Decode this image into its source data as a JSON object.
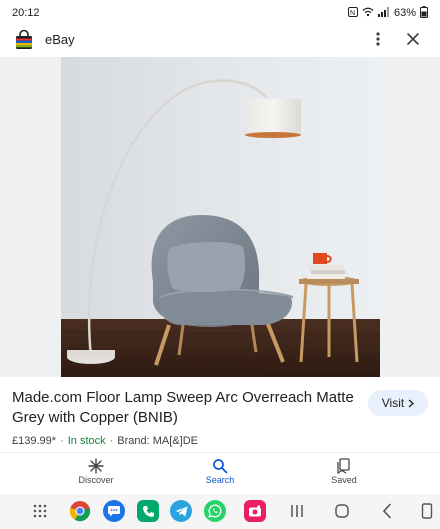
{
  "status_bar": {
    "time": "20:12",
    "battery": "63%",
    "icons": [
      "nfc-icon",
      "wifi-icon",
      "signal-icon"
    ]
  },
  "app_bar": {
    "title": "eBay",
    "app_icon": "shopping-bag-icon",
    "more_icon": "more-vertical-icon",
    "close_icon": "close-icon"
  },
  "product": {
    "title": "Made.com Floor Lamp Sweep Arc Overreach Matte Grey with Copper (BNIB)",
    "price": "£139.99*",
    "stock": "In stock",
    "brand": "Brand: MA[&]DE",
    "visit_label": "Visit",
    "visit_icon": "chevron-right-icon"
  },
  "bottom_nav": {
    "items": [
      {
        "label": "Discover",
        "icon": "asterisk-icon",
        "active": false
      },
      {
        "label": "Search",
        "icon": "search-icon",
        "active": true
      },
      {
        "label": "Saved",
        "icon": "saved-icon",
        "active": false
      }
    ]
  },
  "system_bar": {
    "dock_apps": [
      "chrome-icon",
      "messages-icon",
      "phone-icon",
      "telegram-icon",
      "whatsapp-icon",
      "camera-icon"
    ],
    "nav_icons": [
      "recents-icon",
      "home-icon",
      "back-icon",
      "rotate-icon"
    ]
  },
  "colors": {
    "accent": "#0b57d0",
    "stock_green": "#188038",
    "visit_bg": "#e8f0fe"
  }
}
